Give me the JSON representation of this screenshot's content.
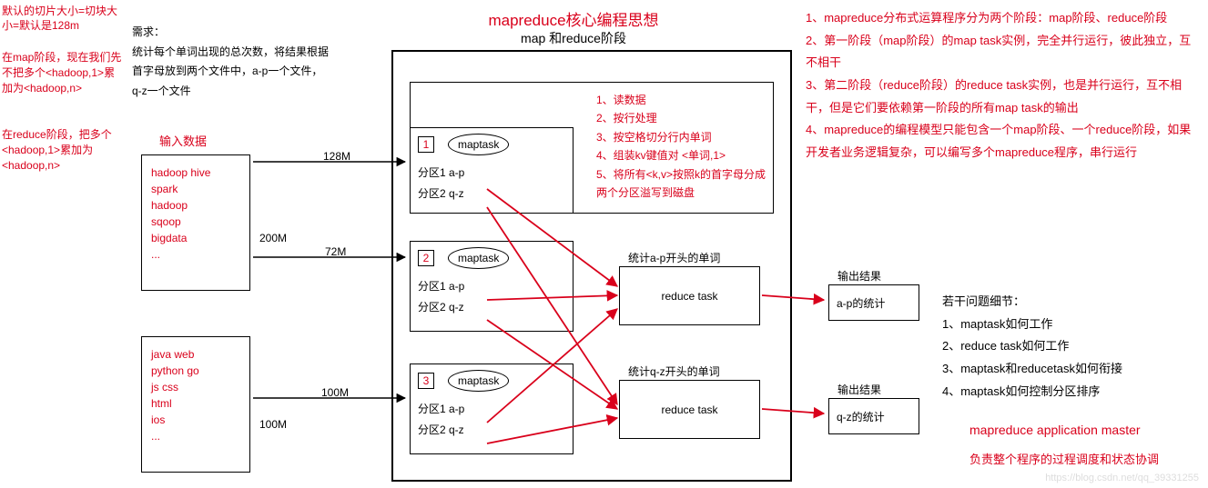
{
  "leftNotes": {
    "n1": "默认的切片大小=切块大小=默认是128m",
    "n2": "在map阶段，现在我们先不把多个<hadoop,1>累加为<hadoop,n>",
    "n3": "在reduce阶段，把多个<hadoop,1>累加为<hadoop,n>"
  },
  "req": {
    "h": "需求：",
    "l1": "统计每个单词出现的总次数，将结果根据",
    "l2": "首字母放到两个文件中，a-p一个文件，",
    "l3": "q-z一个文件"
  },
  "inputLabel": "输入数据",
  "inputBox1": [
    "hadoop hive",
    "spark",
    "hadoop",
    "sqoop",
    "bigdata",
    "..."
  ],
  "inputBox2": [
    "java web",
    "python go",
    "js css",
    "html",
    "ios",
    "..."
  ],
  "sizes": {
    "s128": "128M",
    "s200": "200M",
    "s72": "72M",
    "s100a": "100M",
    "s100b": "100M"
  },
  "titleMain": "mapreduce核心编程思想",
  "titleSub": "map 和reduce阶段",
  "mt": {
    "num1": "1",
    "num2": "2",
    "num3": "3",
    "label": "maptask",
    "p1": "分区1 a-p",
    "p2": "分区2 q-z"
  },
  "steps": [
    "1、读数据",
    "2、按行处理",
    "3、按空格切分行内单词",
    "4、组装kv键值对 <单词,1>",
    "5、将所有<k,v>按照k的首字母分成两个分区溢写到磁盘"
  ],
  "rt": {
    "h1": "统计a-p开头的单词",
    "h2": "统计q-z开头的单词",
    "label": "reduce task"
  },
  "out": {
    "h": "输出结果",
    "v1": "a-p的统计",
    "v2": "q-z的统计"
  },
  "rightTop": [
    "1、mapreduce分布式运算程序分为两个阶段：map阶段、reduce阶段",
    "2、第一阶段（map阶段）的map task实例，完全并行运行，彼此独立，互不相干",
    "3、第二阶段（reduce阶段）的reduce task实例，也是并行运行，互不相干，但是它们要依赖第一阶段的所有map task的输出",
    "4、mapreduce的编程模型只能包含一个map阶段、一个reduce阶段，如果开发者业务逻辑复杂，可以编写多个mapreduce程序，串行运行"
  ],
  "qTitle": "若干问题细节：",
  "questions": [
    "1、maptask如何工作",
    "2、reduce task如何工作",
    "3、maptask和reducetask如何衔接",
    "4、maptask如何控制分区排序"
  ],
  "master": {
    "l1": "mapreduce application master",
    "l2": "负责整个程序的过程调度和状态协调"
  },
  "watermark": "https://blog.csdn.net/qq_39331255"
}
